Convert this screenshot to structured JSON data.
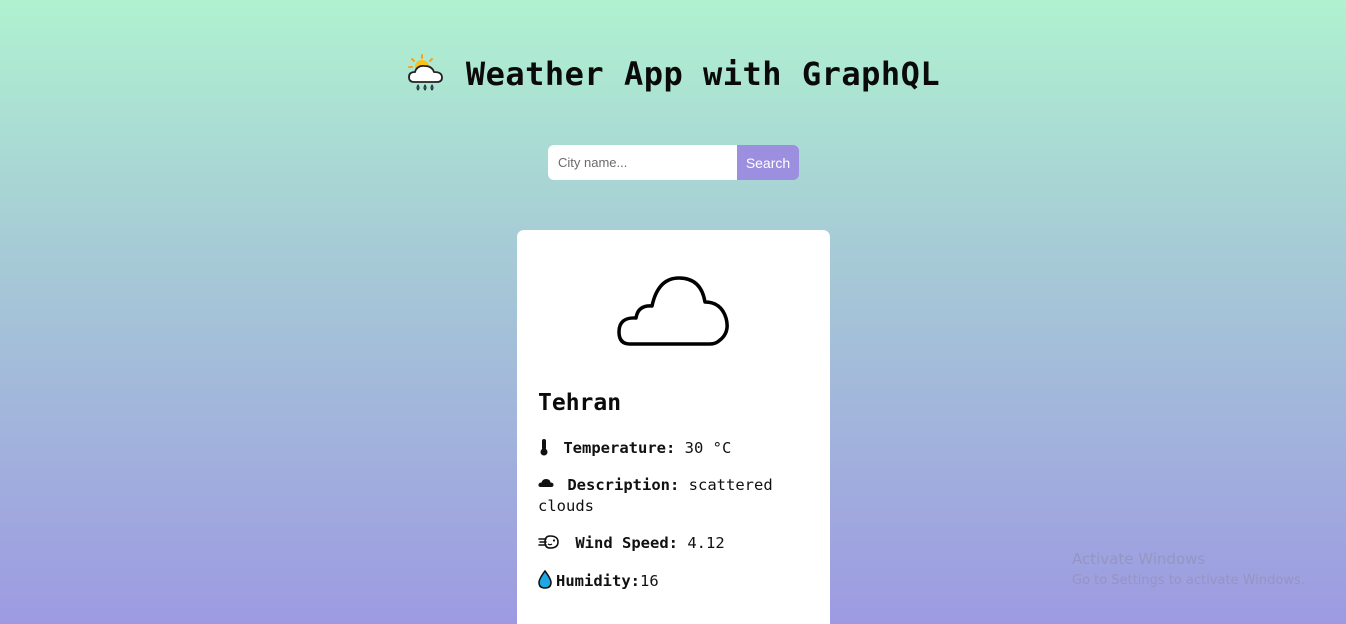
{
  "header": {
    "title": "Weather App with GraphQL",
    "icon": "sun-behind-rain-cloud-icon"
  },
  "search": {
    "placeholder": "City name...",
    "value": "",
    "button_label": "Search"
  },
  "weather": {
    "icon": "cloud-icon",
    "city": "Tehran",
    "temperature_label": "Temperature:",
    "temperature_value": "30 °C",
    "temperature_icon": "thermometer-icon",
    "description_label": "Description:",
    "description_value": "scattered clouds",
    "description_icon": "cloud-icon",
    "wind_label": "Wind Speed:",
    "wind_value": "4.12",
    "wind_icon": "wind-face-icon",
    "humidity_label": "Humidity:",
    "humidity_value": "16",
    "humidity_icon": "droplet-icon"
  },
  "watermark": {
    "title": "Activate Windows",
    "subtitle": "Go to Settings to activate Windows."
  },
  "colors": {
    "gradient_top": "#b0f2d0",
    "gradient_bottom": "#9d9ae2",
    "button_accent": "#9c8fe0",
    "card_background": "#ffffff"
  }
}
